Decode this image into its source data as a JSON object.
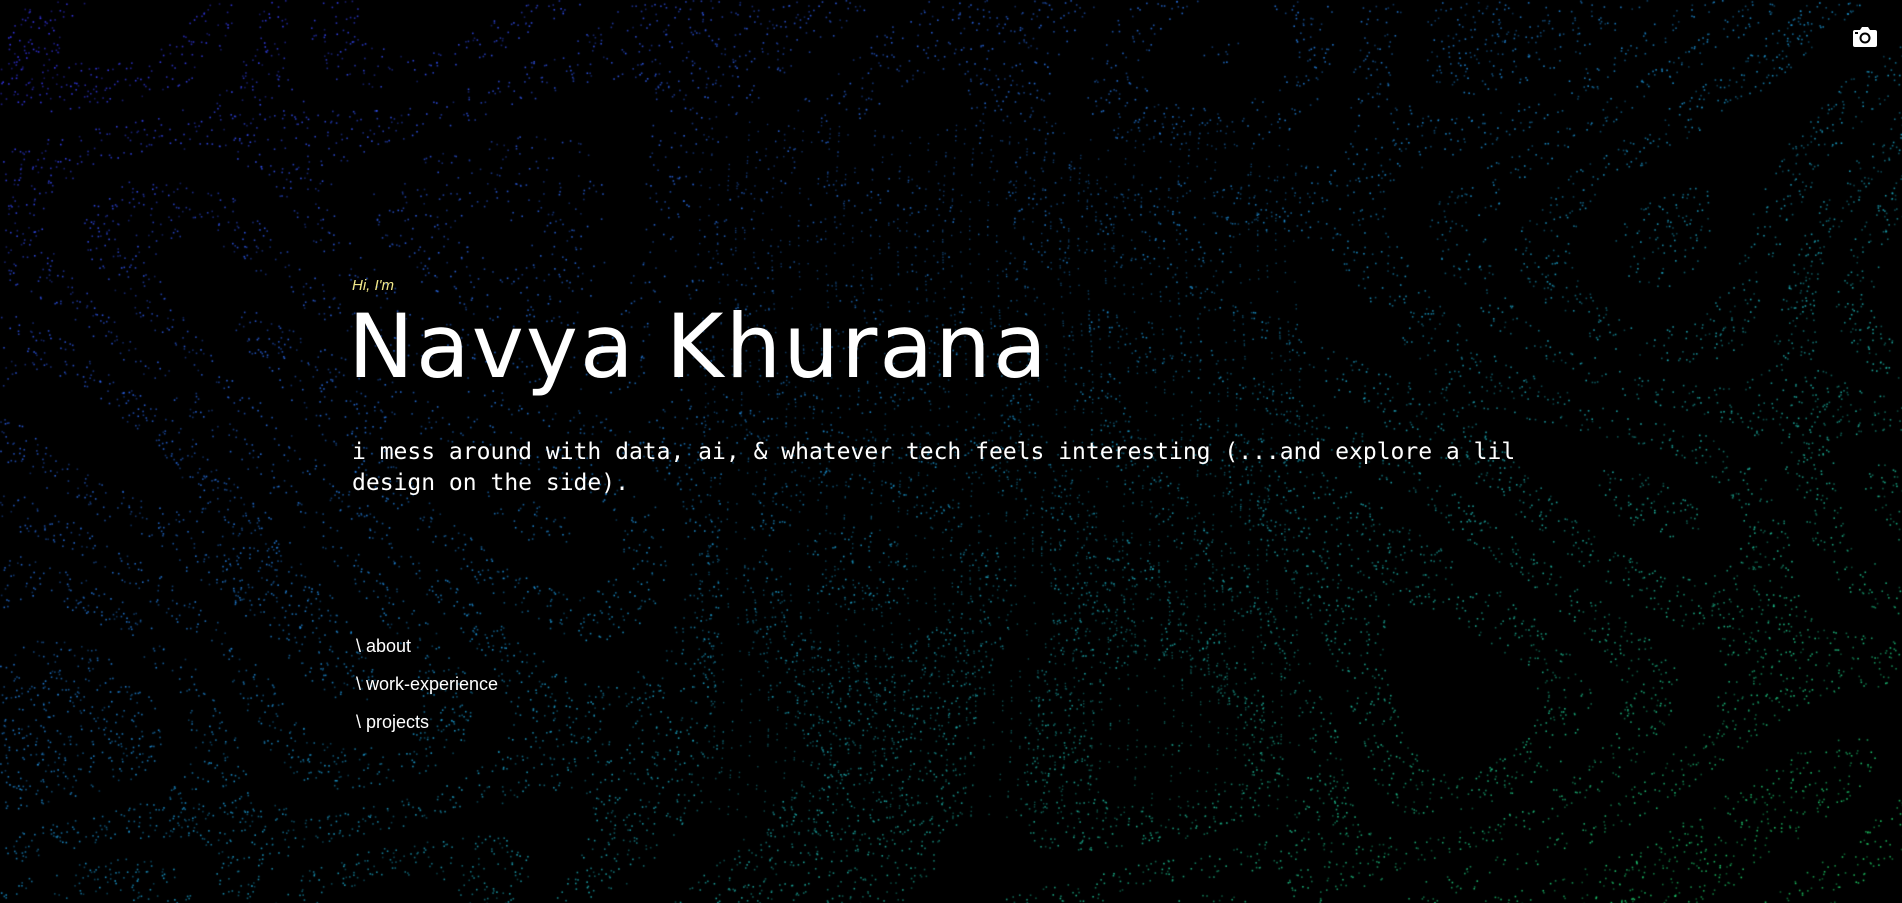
{
  "page": {
    "background_color": "#000000",
    "particle_colors": [
      "#3a3aff",
      "#1b9bd8",
      "#1fd86b"
    ]
  },
  "toolbar": {
    "camera_icon": "camera-icon"
  },
  "hero": {
    "greeting": "Hi, I'm",
    "name": "Navya Khurana",
    "tagline": "i mess around with data, ai, & whatever tech feels interesting (...and explore a lil design on the side).",
    "greeting_color": "#f2e98a"
  },
  "nav": {
    "items": [
      {
        "slash": "\\",
        "label": "about"
      },
      {
        "slash": "\\",
        "label": "work-experience"
      },
      {
        "slash": "\\",
        "label": "projects"
      }
    ]
  }
}
